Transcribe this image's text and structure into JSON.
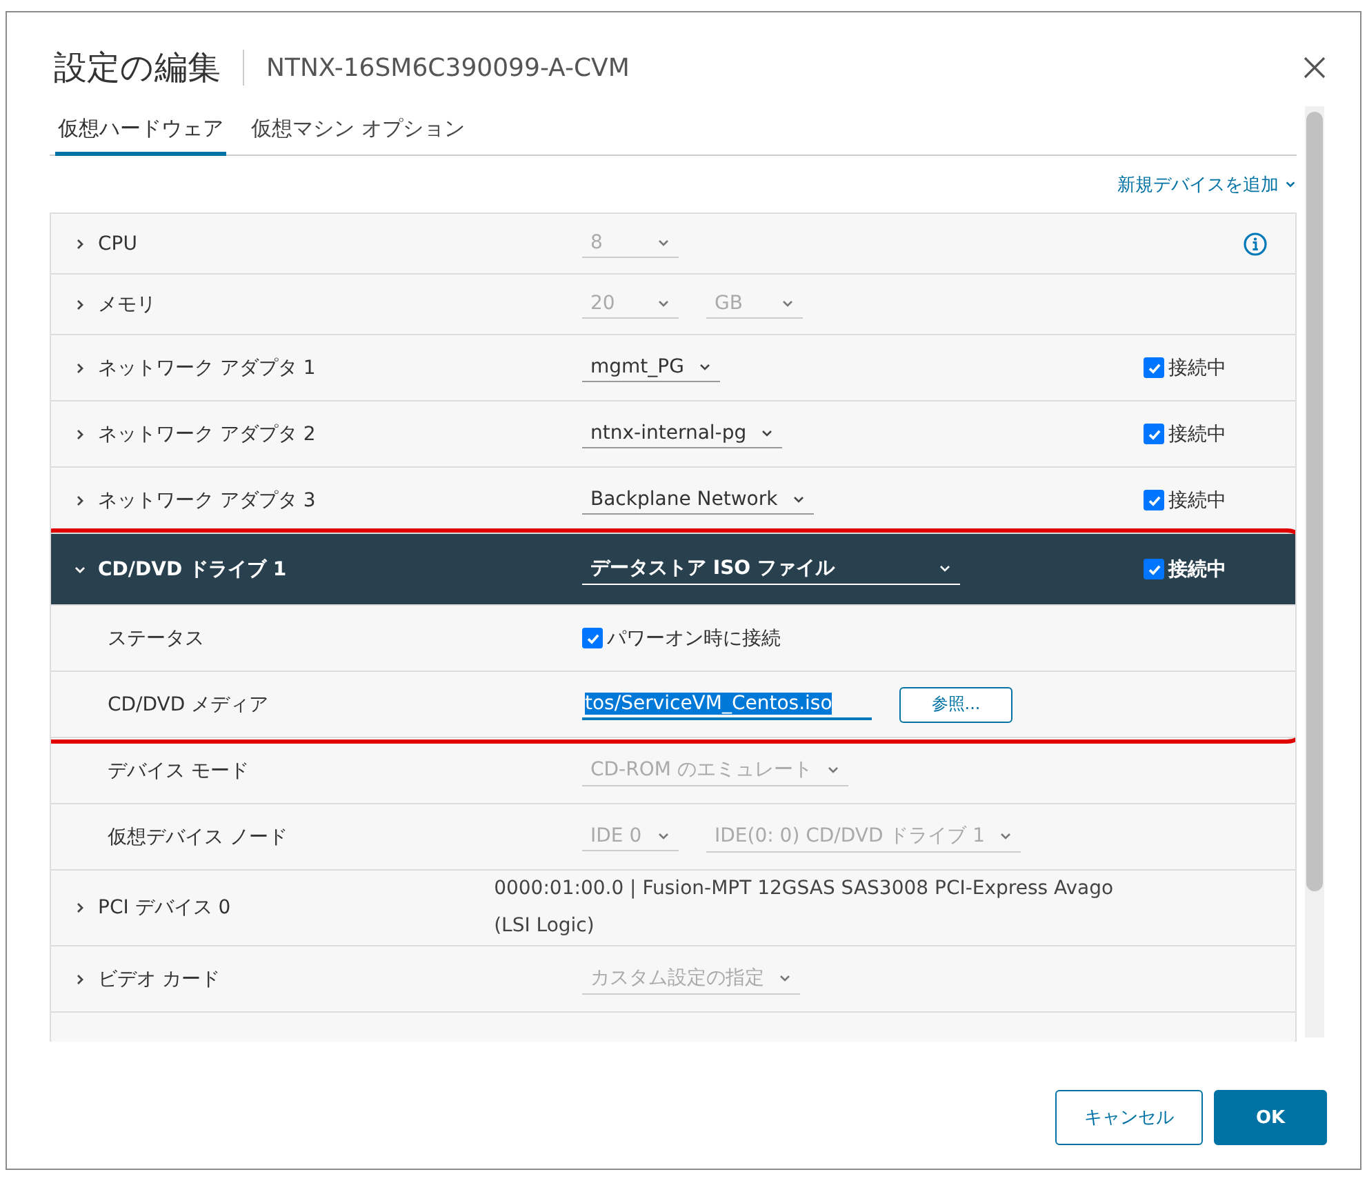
{
  "dialog": {
    "title": "設定の編集",
    "subtitle": "NTNX-16SM6C390099-A-CVM"
  },
  "tabs": [
    {
      "label": "仮想ハードウェア",
      "selected": true
    },
    {
      "label": "仮想マシン オプション",
      "selected": false
    }
  ],
  "add_device": "新規デバイスを追加",
  "devices": [
    {
      "label": "CPU",
      "expanded": false,
      "fields": [
        {
          "value": "8",
          "disabled": true
        }
      ],
      "info": true
    },
    {
      "label": "メモリ",
      "expanded": false,
      "fields": [
        {
          "value": "20",
          "disabled": true
        },
        {
          "value": "GB",
          "disabled": true
        }
      ]
    },
    {
      "label": "ネットワーク アダプタ 1",
      "expanded": false,
      "fields": [
        {
          "value": "mgmt_PG",
          "disabled": false
        }
      ],
      "connected": {
        "label": "接続中",
        "checked": true
      }
    },
    {
      "label": "ネットワーク アダプタ 2",
      "expanded": false,
      "fields": [
        {
          "value": "ntnx-internal-pg",
          "disabled": false
        }
      ],
      "connected": {
        "label": "接続中",
        "checked": true
      }
    },
    {
      "label": "ネットワーク アダプタ 3",
      "expanded": false,
      "fields": [
        {
          "value": "Backplane Network",
          "disabled": false
        }
      ],
      "connected": {
        "label": "接続中",
        "checked": true
      }
    },
    {
      "label": "CD/DVD ドライブ 1",
      "expanded": true,
      "highlighted": true,
      "fields": [
        {
          "value": "データストア ISO ファイル",
          "disabled": false
        }
      ],
      "connected": {
        "label": "接続中",
        "checked": true
      },
      "children": [
        {
          "label": "ステータス",
          "highlighted": true,
          "checkbox": {
            "label": "パワーオン時に接続",
            "checked": true
          }
        },
        {
          "label": "CD/DVD メディア",
          "highlighted": true,
          "input": {
            "value": "tos/ServiceVM_Centos.iso",
            "text_selected": true
          },
          "button": "参照..."
        },
        {
          "label": "デバイス モード",
          "highlighted": false,
          "fields": [
            {
              "value": "CD-ROM のエミュレート",
              "disabled": true
            }
          ]
        },
        {
          "label": "仮想デバイス ノード",
          "highlighted": false,
          "fields": [
            {
              "value": "IDE 0",
              "disabled": true
            },
            {
              "value": "IDE(0: 0) CD/DVD ドライブ 1",
              "disabled": true
            }
          ]
        }
      ]
    },
    {
      "label": "PCI デバイス 0",
      "expanded": false,
      "text": "0000:01:00.0 | Fusion-MPT 12GSAS SAS3008 PCI-Express Avago (LSI Logic)"
    },
    {
      "label": "ビデオ カード",
      "expanded": false,
      "fields": [
        {
          "value": "カスタム設定の指定",
          "disabled": true
        }
      ]
    }
  ],
  "buttons": [
    {
      "label": "キャンセル",
      "kind": "secondary"
    },
    {
      "label": "OK",
      "kind": "primary"
    }
  ]
}
